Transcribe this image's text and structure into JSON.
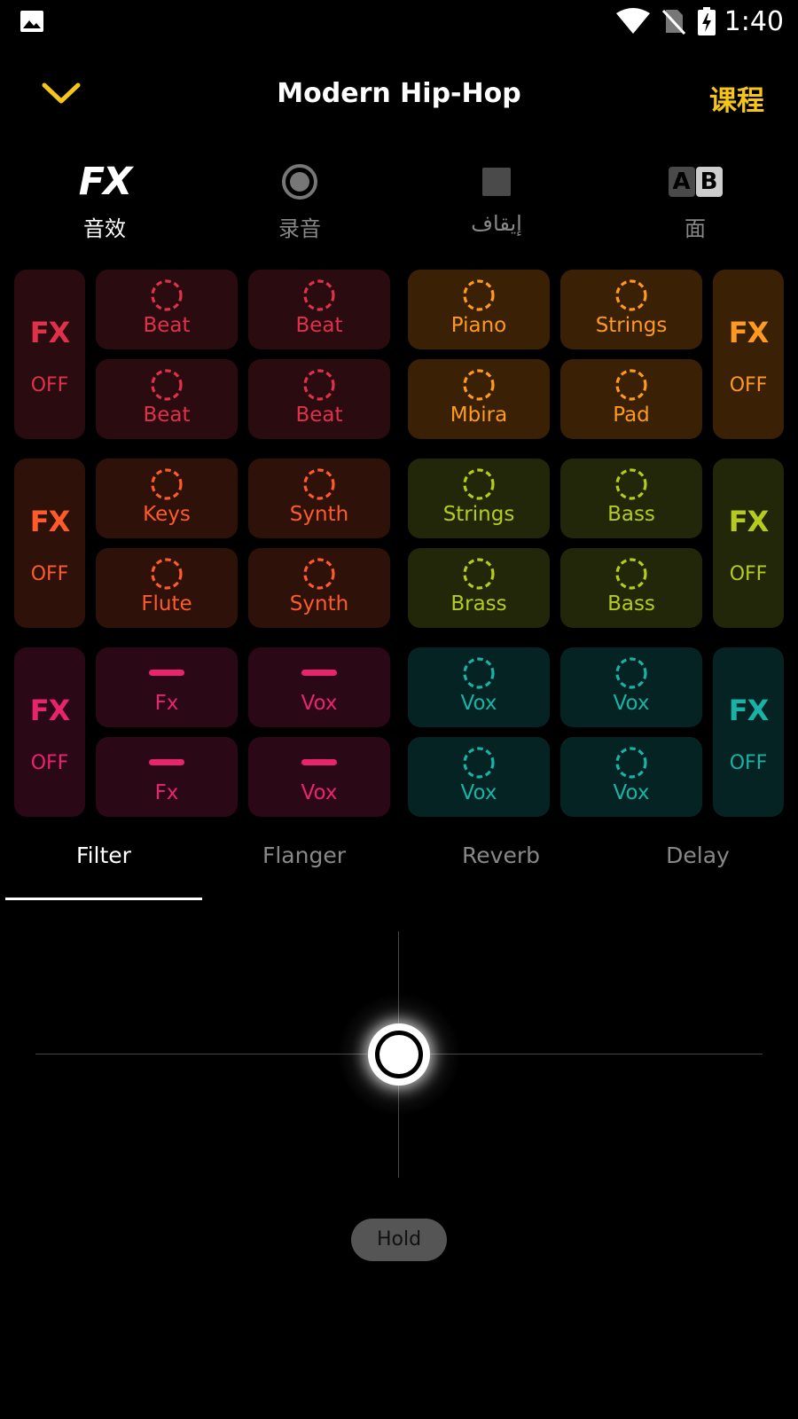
{
  "status_bar": {
    "time": "1:40",
    "icons": [
      "gallery-icon",
      "wifi-icon",
      "no-sim-icon",
      "battery-charging-icon"
    ]
  },
  "header": {
    "title": "Modern Hip-Hop",
    "course_label": "课程",
    "accent": "#f5c518"
  },
  "modes": [
    {
      "icon": "fx-logo",
      "logo_text": "FX",
      "label": "音效"
    },
    {
      "icon": "record-icon",
      "label": "录音"
    },
    {
      "icon": "stop-icon",
      "label": "إيقاف"
    },
    {
      "icon": "ab-icon",
      "a": "A",
      "b": "B",
      "label": "面"
    }
  ],
  "pads": {
    "group1": {
      "color": "#e0314b",
      "bg": "#2a0c10",
      "fx": "FX",
      "off": "OFF",
      "labels": [
        "Beat",
        "Beat",
        "Beat",
        "Beat"
      ]
    },
    "group2": {
      "color": "#ff9a1f",
      "bg": "#3a2106",
      "fx": "FX",
      "off": "OFF",
      "labels": [
        "Piano",
        "Strings",
        "Mbira",
        "Pad"
      ]
    },
    "group3": {
      "color": "#ff5a2a",
      "bg": "#2e1209",
      "fx": "FX",
      "off": "OFF",
      "labels": [
        "Keys",
        "Synth",
        "Flute",
        "Synth"
      ]
    },
    "group4": {
      "color": "#b5cc1f",
      "bg": "#232709",
      "fx": "FX",
      "off": "OFF",
      "labels": [
        "Strings",
        "Bass",
        "Brass",
        "Bass"
      ]
    },
    "group5": {
      "color": "#e8256b",
      "bg": "#2a0816",
      "fx": "FX",
      "off": "OFF",
      "labels": [
        "Fx",
        "Vox",
        "Fx",
        "Vox"
      ]
    },
    "group6": {
      "color": "#18b3a6",
      "bg": "#052322",
      "fx": "FX",
      "off": "OFF",
      "labels": [
        "Vox",
        "Vox",
        "Vox",
        "Vox"
      ]
    }
  },
  "effects": {
    "tabs": [
      "Filter",
      "Flanger",
      "Reverb",
      "Delay"
    ],
    "active": "Filter"
  },
  "hold_label": "Hold"
}
